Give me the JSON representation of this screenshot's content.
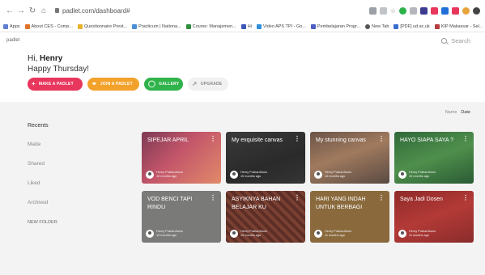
{
  "browser": {
    "url": "padlet.com/dashboard#",
    "bookmarks": [
      {
        "label": "Apps",
        "color": "#5f7fd3"
      },
      {
        "label": "About CES - Comp...",
        "color": "#e0732a"
      },
      {
        "label": "Questionnaire Prest...",
        "color": "#e8b22a"
      },
      {
        "label": "Practicum | Nationa...",
        "color": "#4a8fd6"
      },
      {
        "label": "Course: Manajemen...",
        "color": "#2f8f3f"
      },
      {
        "label": "Hi",
        "color": "#3a56b8"
      },
      {
        "label": "Video APS TPI - Go...",
        "color": "#2f8fde"
      },
      {
        "label": "Pembelajaran Progr...",
        "color": "#4b5fc4"
      },
      {
        "label": "New Tab",
        "color": "#555555"
      },
      {
        "label": "[PDF] ud.ac.uk",
        "color": "#3a6cd0"
      },
      {
        "label": "KIP Makassar - Sel...",
        "color": "#b53d3d"
      }
    ]
  },
  "header": {
    "brand": "padlet",
    "search_placeholder": "Search",
    "greeting_prefix": "Hi,",
    "greeting_name": "Henry",
    "subtitle": "Happy Thursday!"
  },
  "actions": {
    "make": "MAKE A PADLET",
    "join": "JOIN A PADLET",
    "gallery": "GALLERY",
    "upgrade": "UPGRADE"
  },
  "sort": {
    "name": "Name",
    "date": "Date"
  },
  "sidebar": {
    "recents": "Recents",
    "made": "Made",
    "shared": "Shared",
    "liked": "Liked",
    "archived": "Archived",
    "new_folder": "NEW FOLDER"
  },
  "cards": [
    {
      "title": "SIPEJAR APRIL",
      "author": "Henry Prahardhono",
      "time": "10 months ago",
      "color": "#b0495a"
    },
    {
      "title": "My exquisite canvas",
      "author": "Henry Prahardhono",
      "time": "10 months ago",
      "color": "#2f2f2f"
    },
    {
      "title": "My stunning canvas",
      "author": "Henry Prahardhono",
      "time": "10 months ago",
      "color": "#8c6a52"
    },
    {
      "title": "HAYO SIAPA SAYA ?",
      "author": "Henry Prahardhono",
      "time": "10 months ago",
      "color": "#3f7a45"
    },
    {
      "title": "VOD BENCI TAPI RINDU",
      "author": "Henry Prahardhono",
      "time": "10 months ago",
      "color": "#7a7a7a"
    },
    {
      "title": "ASYIKNYA BAHAN BELAJAR KU",
      "author": "Henry Prahardhono",
      "time": "10 months ago",
      "color": "#6b3a2f"
    },
    {
      "title": "HARI YANG INDAH UNTUK BERBAGI",
      "author": "Henry Prahardhono",
      "time": "11 months ago",
      "color": "#8a6a3d"
    },
    {
      "title": "Saya Jadi Dosen",
      "author": "Henry Prahardhono",
      "time": "11 months ago",
      "color": "#a3312f"
    }
  ]
}
